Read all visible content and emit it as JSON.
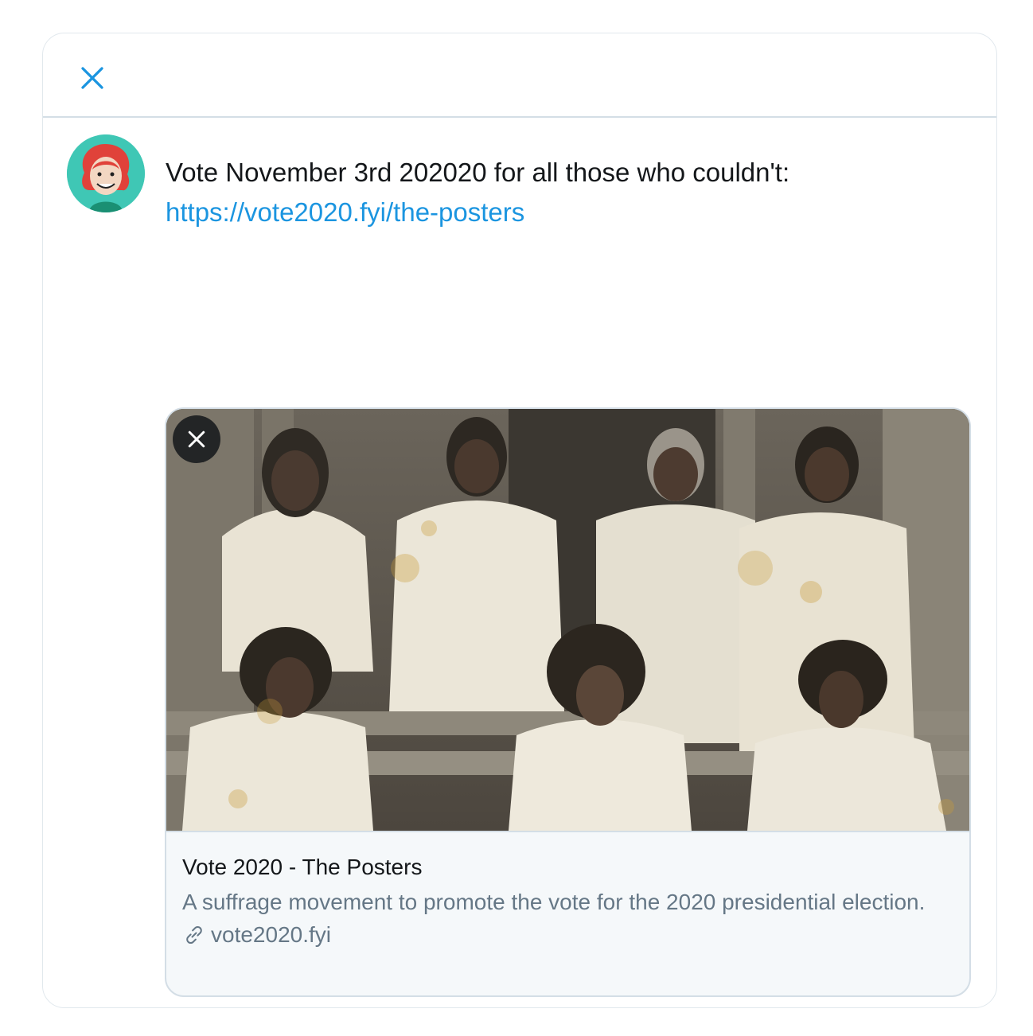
{
  "header": {
    "close_icon": "close-icon",
    "accent_color": "#1b95e0"
  },
  "tweet": {
    "avatar_icon": "avatar-illustration",
    "text": "Vote November 3rd 202020 for all those who couldn't:",
    "link": "https://vote2020.fyi/the-posters"
  },
  "card": {
    "image_description_icon": "photo",
    "dismiss_icon": "close-icon",
    "title": "Vote 2020 - The Posters",
    "description": "A suffrage movement to promote the vote for the 2020 presidential election.",
    "domain": "vote2020.fyi",
    "domain_icon": "link-icon"
  }
}
